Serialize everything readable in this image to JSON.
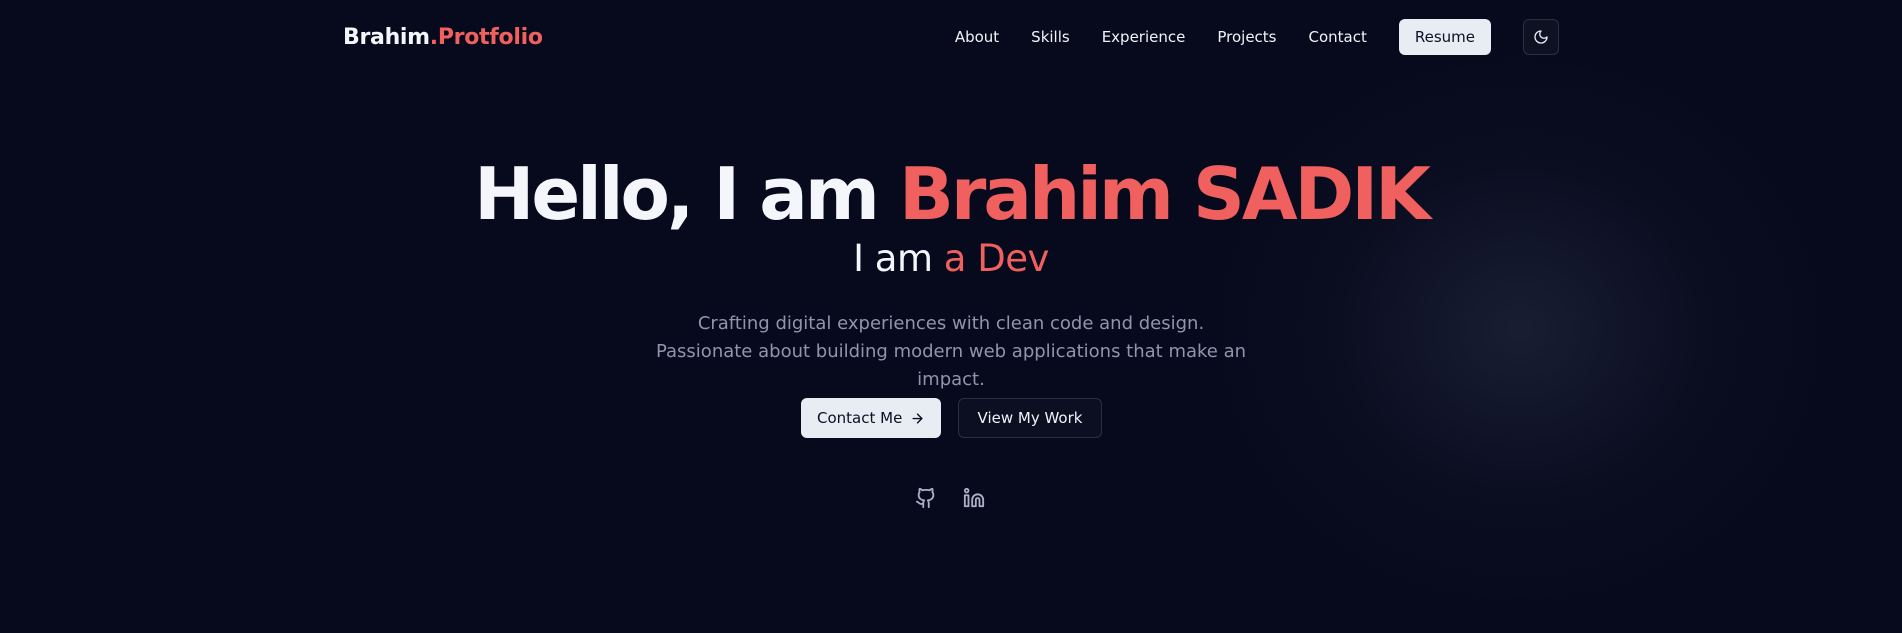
{
  "brand": {
    "name": "Brahim",
    "suffix": ".Protfolio"
  },
  "nav": {
    "links": [
      {
        "label": "About"
      },
      {
        "label": "Skills"
      },
      {
        "label": "Experience"
      },
      {
        "label": "Projects"
      },
      {
        "label": "Contact"
      }
    ],
    "resume_label": "Resume",
    "theme_icon": "moon-icon"
  },
  "hero": {
    "greeting": "Hello, I am ",
    "name": "Brahim SADIK",
    "sub_prefix": "I am ",
    "sub_role": "a Dev",
    "description": "Crafting digital experiences with clean code and design. Passionate about building modern web applications that make an impact.",
    "primary_cta": "Contact Me",
    "secondary_cta": "View My Work"
  },
  "socials": [
    {
      "icon": "github-icon"
    },
    {
      "icon": "linkedin-icon"
    }
  ],
  "colors": {
    "background": "#070a1c",
    "accent": "#f0605f",
    "text": "#f4f6fb",
    "muted": "#8f96ab",
    "button_light": "#e8ecf3"
  }
}
